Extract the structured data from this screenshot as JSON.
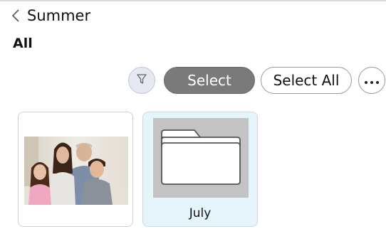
{
  "header": {
    "back_icon": "chevron-left-icon",
    "title": "Summer"
  },
  "filter": {
    "label": "All"
  },
  "toolbar": {
    "filter_icon": "filter-funnel-icon",
    "select_label": "Select",
    "select_all_label": "Select All",
    "more_icon": "more-horizontal-icon",
    "select_color": "#7a7a7a",
    "filter_bg": "#e6e8f2"
  },
  "items": [
    {
      "type": "photo",
      "name": ""
    },
    {
      "type": "folder",
      "name": "July",
      "selected_bg": "#e6f4fc"
    }
  ]
}
